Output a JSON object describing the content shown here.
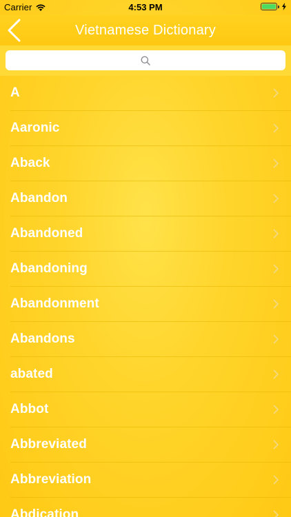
{
  "status_bar": {
    "carrier": "Carrier",
    "time": "4:53 PM",
    "battery_level": 1.0,
    "battery_color": "#4cd964",
    "icons": [
      "wifi-icon",
      "battery-icon",
      "charging-icon"
    ]
  },
  "nav": {
    "title": "Vietnamese Dictionary",
    "back_icon": "chevron-left-icon"
  },
  "search": {
    "placeholder": "",
    "value": "",
    "icon": "search-icon"
  },
  "list": {
    "row_icon": "chevron-right-icon",
    "items": [
      {
        "label": "A"
      },
      {
        "label": "Aaronic"
      },
      {
        "label": "Aback"
      },
      {
        "label": "Abandon"
      },
      {
        "label": "Abandoned"
      },
      {
        "label": "Abandoning"
      },
      {
        "label": "Abandonment"
      },
      {
        "label": "Abandons"
      },
      {
        "label": "abated"
      },
      {
        "label": "Abbot"
      },
      {
        "label": "Abbreviated"
      },
      {
        "label": "Abbreviation"
      },
      {
        "label": "Abdication"
      }
    ]
  },
  "colors": {
    "accent": "#ffc812",
    "search_bar_bg": "#ffd935",
    "text": "#ffffff"
  }
}
